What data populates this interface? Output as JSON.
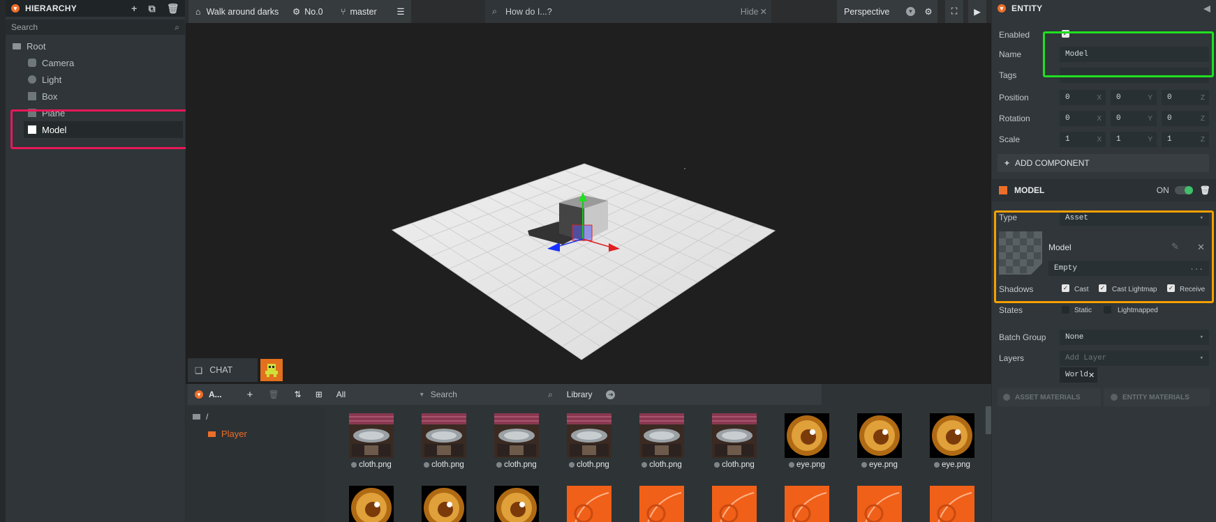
{
  "hierarchy": {
    "title": "HIERARCHY",
    "search_placeholder": "Search",
    "items": [
      {
        "label": "Root"
      },
      {
        "label": "Camera"
      },
      {
        "label": "Light"
      },
      {
        "label": "Box"
      },
      {
        "label": "Plane"
      },
      {
        "label": "Model"
      }
    ]
  },
  "toolbar": {
    "project": "Walk around darks",
    "scene": "No.0",
    "branch": "master",
    "help_search": "How do I...?",
    "hide": "Hide",
    "camera": "Perspective"
  },
  "chat": {
    "label": "CHAT"
  },
  "assets": {
    "title": "A...",
    "filter": "All",
    "search_placeholder": "Search",
    "library": "Library",
    "folders": [
      {
        "label": "/"
      },
      {
        "label": "Player"
      }
    ],
    "row1": [
      "cloth.png",
      "cloth.png",
      "cloth.png",
      "cloth.png",
      "cloth.png",
      "cloth.png",
      "eye.png",
      "eye.png",
      "eye.png"
    ]
  },
  "entity": {
    "title": "ENTITY",
    "enabled_label": "Enabled",
    "name_label": "Name",
    "name_value": "Model",
    "tags_label": "Tags",
    "position_label": "Position",
    "rotation_label": "Rotation",
    "scale_label": "Scale",
    "position": [
      "0",
      "0",
      "0"
    ],
    "rotation": [
      "0",
      "0",
      "0"
    ],
    "scale": [
      "1",
      "1",
      "1"
    ],
    "axes": [
      "X",
      "Y",
      "Z"
    ],
    "add_component": "ADD COMPONENT"
  },
  "model": {
    "title": "MODEL",
    "on_label": "ON",
    "type_label": "Type",
    "type_value": "Asset",
    "model_label": "Model",
    "model_value": "Empty",
    "dots": "...",
    "shadows_label": "Shadows",
    "cast": "Cast",
    "cast_lightmap": "Cast Lightmap",
    "receive": "Receive",
    "states_label": "States",
    "static": "Static",
    "lightmapped": "Lightmapped",
    "batch_label": "Batch Group",
    "batch_value": "None",
    "layers_label": "Layers",
    "add_layer": "Add Layer",
    "layer_tag": "World",
    "asset_materials": "ASSET MATERIALS",
    "entity_materials": "ENTITY MATERIALS"
  },
  "colors": {
    "accent": "#ec6e29",
    "highlight_red": "#e8185a",
    "highlight_green": "#20e020",
    "highlight_orange": "#f5a000"
  }
}
